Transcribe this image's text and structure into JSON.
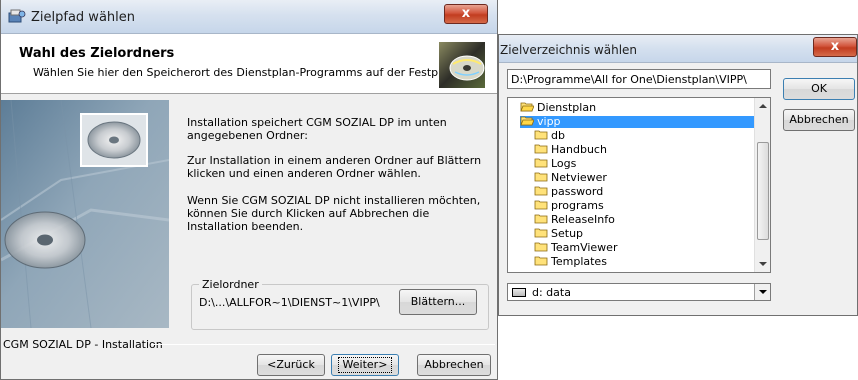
{
  "install_window": {
    "title": "Zielpfad wählen",
    "close_label": "x",
    "header": {
      "title": "Wahl des Zielordners",
      "subtitle": "Wählen Sie hier den Speicherort des Dienstplan-Programms auf der Festplatte."
    },
    "paragraphs": [
      "Installation speichert CGM SOZIAL DP im unten angegebenen Ordner:",
      "Zur Installation in einem anderen Ordner auf Blättern klicken und einen anderen Ordner wählen.",
      "Wenn Sie CGM SOZIAL DP nicht installieren möchten, können Sie durch Klicken auf Abbrechen die Installation beenden."
    ],
    "target_folder": {
      "legend": "Zielordner",
      "path": "D:\\...\\ALLFOR~1\\DIENST~1\\VIPP\\",
      "browse_label": "Blättern..."
    },
    "footer_label": "CGM SOZIAL DP - Installation",
    "buttons": {
      "back": "<Zurück",
      "next": "Weiter>",
      "cancel": "Abbrechen"
    }
  },
  "folder_dialog": {
    "title": "Zielverzeichnis wählen",
    "close_label": "x",
    "path_value": "D:\\Programme\\All for One\\Dienstplan\\VIPP\\",
    "ok_label": "OK",
    "cancel_label": "Abbrechen",
    "tree": [
      {
        "label": "Dienstplan",
        "open": true,
        "selected": false,
        "level": 0
      },
      {
        "label": "vipp",
        "open": true,
        "selected": true,
        "level": 0
      },
      {
        "label": "db",
        "level": 1
      },
      {
        "label": "Handbuch",
        "level": 1
      },
      {
        "label": "Logs",
        "level": 1
      },
      {
        "label": "Netviewer",
        "level": 1
      },
      {
        "label": "password",
        "level": 1
      },
      {
        "label": "programs",
        "level": 1
      },
      {
        "label": "ReleaseInfo",
        "level": 1
      },
      {
        "label": "Setup",
        "level": 1
      },
      {
        "label": "TeamViewer",
        "level": 1
      },
      {
        "label": "Templates",
        "level": 1
      }
    ],
    "drive": "d: data"
  },
  "colors": {
    "selection": "#3399ff",
    "folder": "#ffd84a",
    "close_button": "#c23c20"
  }
}
